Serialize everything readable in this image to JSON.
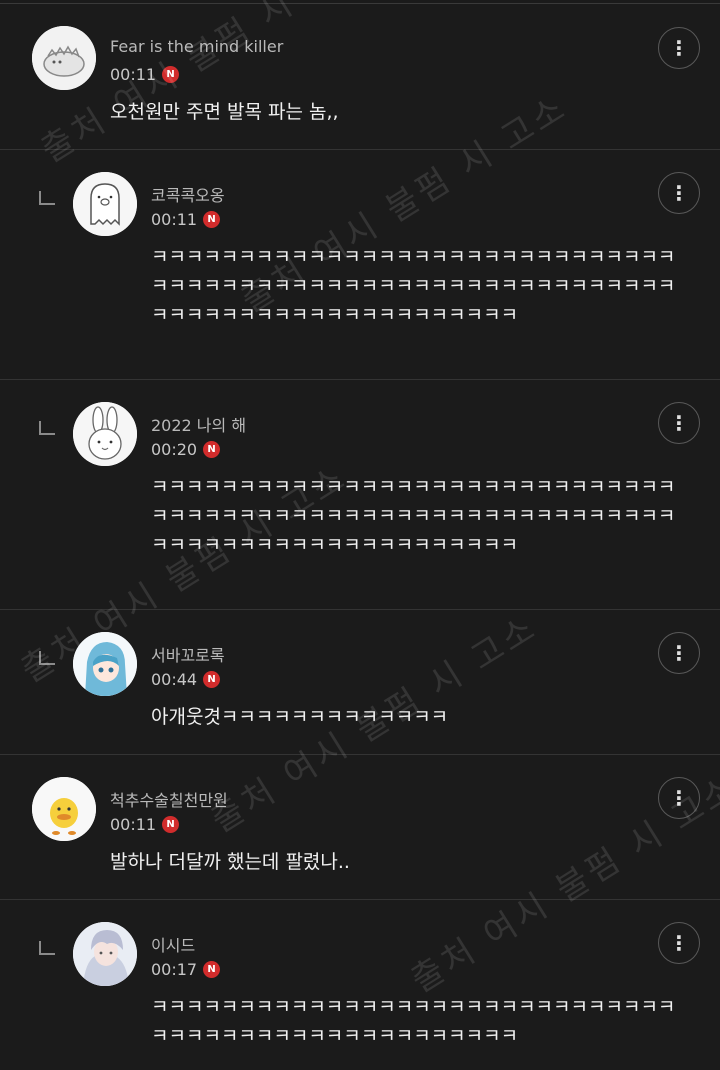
{
  "comments": [
    {
      "nickname": "Fear is the mind killer",
      "time": "00:11",
      "badge": "N",
      "text": "오천원만 주면 발목 파는 놈,,",
      "avatar": "dinosaur-avatar"
    },
    {
      "nickname": "코콕콕오옹",
      "time": "00:11",
      "badge": "N",
      "text": "ㅋㅋㅋㅋㅋㅋㅋㅋㅋㅋㅋㅋㅋㅋㅋㅋㅋㅋㅋㅋㅋㅋㅋㅋㅋㅋㅋㅋㅋㅋㅋㅋㅋㅋㅋㅋㅋㅋㅋㅋㅋㅋㅋㅋㅋㅋㅋㅋㅋㅋㅋㅋㅋㅋㅋㅋㅋㅋㅋㅋㅋㅋㅋㅋㅋㅋㅋㅋㅋㅋㅋㅋㅋㅋㅋㅋㅋㅋㅋㅋㅋ",
      "avatar": "pig-ghost-avatar"
    },
    {
      "nickname": "2022 나의 해",
      "time": "00:20",
      "badge": "N",
      "text": "ㅋㅋㅋㅋㅋㅋㅋㅋㅋㅋㅋㅋㅋㅋㅋㅋㅋㅋㅋㅋㅋㅋㅋㅋㅋㅋㅋㅋㅋㅋㅋㅋㅋㅋㅋㅋㅋㅋㅋㅋㅋㅋㅋㅋㅋㅋㅋㅋㅋㅋㅋㅋㅋㅋㅋㅋㅋㅋㅋㅋㅋㅋㅋㅋㅋㅋㅋㅋㅋㅋㅋㅋㅋㅋㅋㅋㅋㅋㅋㅋㅋ",
      "avatar": "rabbit-avatar"
    },
    {
      "nickname": "서바꼬로록",
      "time": "00:44",
      "badge": "N",
      "text": "아개웃겻ㅋㅋㅋㅋㅋㅋㅋㅋㅋㅋㅋㅋㅋ",
      "avatar": "anime-girl-avatar"
    },
    {
      "nickname": "척추수술칠천만원",
      "time": "00:11",
      "badge": "N",
      "text": "발하나 더달까 했는데 팔렸나..",
      "avatar": "duck-avatar"
    },
    {
      "nickname": "이시드",
      "time": "00:17",
      "badge": "N",
      "text": "ㅋㅋㅋㅋㅋㅋㅋㅋㅋㅋㅋㅋㅋㅋㅋㅋㅋㅋㅋㅋㅋㅋㅋㅋㅋㅋㅋㅋㅋㅋㅋㅋㅋㅋㅋㅋㅋㅋㅋㅋㅋㅋㅋㅋㅋㅋㅋㅋㅋㅋㅋ",
      "avatar": "anime-boy-avatar"
    }
  ],
  "more_label": "⋮",
  "watermark": "출처 여시 불펌 시 고소",
  "colors": {
    "background": "#1b1b1b",
    "badge": "#d12c2c",
    "nickname": "#b9b9b9",
    "text": "#f1f1f1"
  }
}
